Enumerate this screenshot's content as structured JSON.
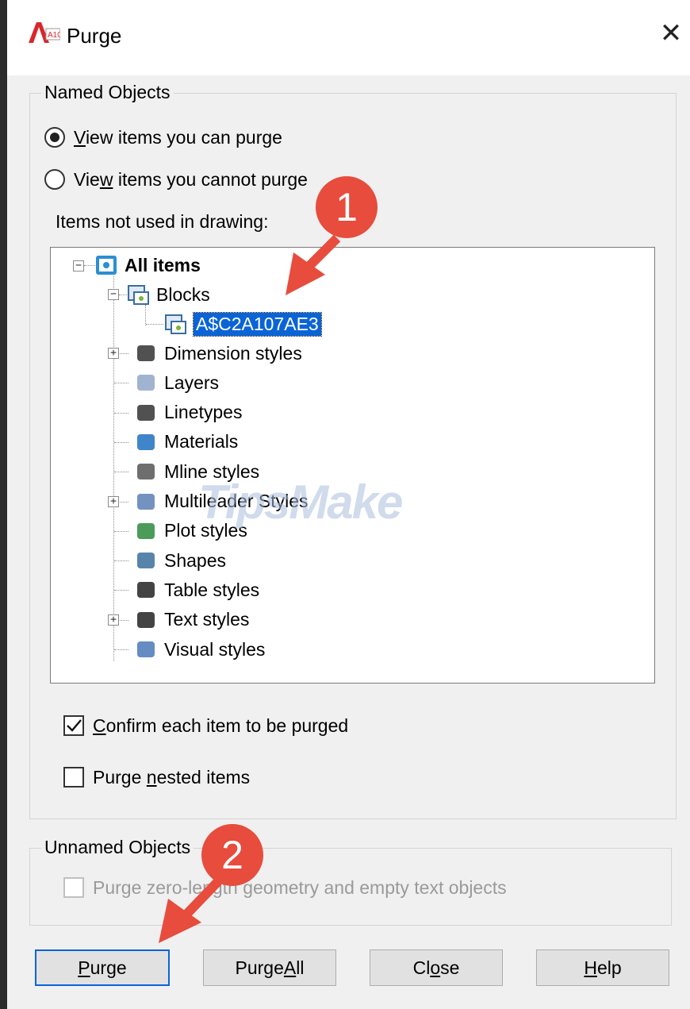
{
  "window": {
    "title": "Purge",
    "app_badge": "A10",
    "close_symbol": "✕"
  },
  "named_objects": {
    "group_label": "Named Objects",
    "radio_can": {
      "before": "",
      "mnemonic": "V",
      "after": "iew items you can purge",
      "checked": true
    },
    "radio_cannot": {
      "before": "Vie",
      "mnemonic": "w",
      "after": " items you cannot purge",
      "checked": false
    },
    "tree_caption": "Items not used in drawing:",
    "tree": {
      "root": "All items",
      "blocks": "Blocks",
      "block_child": "A$C2A107AE3",
      "items": [
        "Dimension styles",
        "Layers",
        "Linetypes",
        "Materials",
        "Mline styles",
        "Multileader Styles",
        "Plot styles",
        "Shapes",
        "Table styles",
        "Text styles",
        "Visual styles"
      ]
    },
    "confirm": {
      "before": "",
      "mnemonic": "C",
      "after": "onfirm each item to be purged",
      "checked": true
    },
    "nested": {
      "before": "Purge ",
      "mnemonic": "n",
      "after": "ested items",
      "checked": false
    }
  },
  "unnamed_objects": {
    "group_label": "Unnamed Objects",
    "zero_length": {
      "text": "Purge zero-length geometry and empty text objects",
      "checked": false,
      "enabled": false
    }
  },
  "buttons": {
    "purge": {
      "before": "",
      "mnemonic": "P",
      "after": "urge"
    },
    "purge_all": {
      "before": "Purge ",
      "mnemonic": "A",
      "after": "ll"
    },
    "close": {
      "before": "Cl",
      "mnemonic": "o",
      "after": "se"
    },
    "help": {
      "before": "",
      "mnemonic": "H",
      "after": "elp"
    }
  },
  "annotations": {
    "step1": "1",
    "step2": "2"
  },
  "watermark": "TipsMake",
  "colors": {
    "selection": "#0a64d6",
    "badge": "#e74c3c"
  }
}
